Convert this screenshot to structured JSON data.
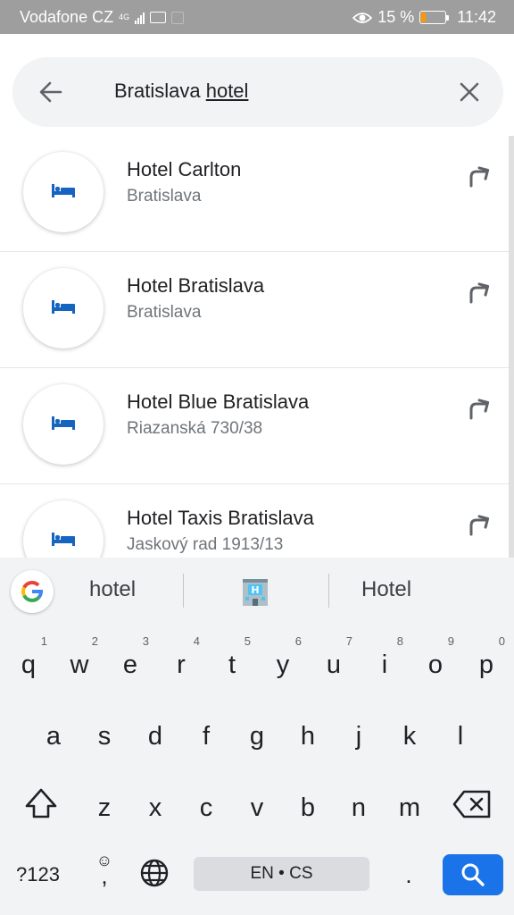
{
  "status_bar": {
    "carrier": "Vodafone CZ",
    "network": "4G",
    "battery_percent": "15 %",
    "battery_level": 0.15,
    "time": "11:42"
  },
  "search": {
    "query_prefix": "Bratislava ",
    "query_highlight": "hotel",
    "back_icon": "arrow-back-icon",
    "clear_icon": "close-icon"
  },
  "results": [
    {
      "title": "Hotel Carlton",
      "subtitle": "Bratislava"
    },
    {
      "title": "Hotel Bratislava",
      "subtitle": "Bratislava"
    },
    {
      "title": "Hotel Blue Bratislava",
      "subtitle": "Riazanská 730/38"
    },
    {
      "title": "Hotel Taxis Bratislava",
      "subtitle": "Jaskový rad 1913/13"
    }
  ],
  "colors": {
    "accent": "#1a73e8",
    "hotel_icon": "#1565c0"
  },
  "keyboard": {
    "suggestions": [
      "hotel",
      "Hotel"
    ],
    "suggestion_emoji": "hotel-emoji",
    "row1": [
      "q",
      "w",
      "e",
      "r",
      "t",
      "y",
      "u",
      "i",
      "o",
      "p"
    ],
    "row1_numbers": [
      "1",
      "2",
      "3",
      "4",
      "5",
      "6",
      "7",
      "8",
      "9",
      "0"
    ],
    "row2": [
      "a",
      "s",
      "d",
      "f",
      "g",
      "h",
      "j",
      "k",
      "l"
    ],
    "row3": [
      "z",
      "x",
      "c",
      "v",
      "b",
      "n",
      "m"
    ],
    "symbols_label": "?123",
    "comma_label": ",",
    "emoji_label": "☺",
    "space_label": "EN • CS",
    "period_label": "."
  }
}
